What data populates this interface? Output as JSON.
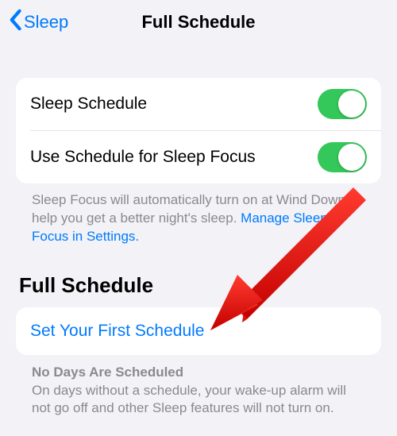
{
  "nav": {
    "back_label": "Sleep",
    "title": "Full Schedule"
  },
  "card1": {
    "row1_label": "Sleep Schedule",
    "row1_toggle_on": true,
    "row2_label": "Use Schedule for Sleep Focus",
    "row2_toggle_on": true
  },
  "footer1": {
    "text": "Sleep Focus will automatically turn on at Wind Down to help you get a better night's sleep. ",
    "link": "Manage Sleep Focus in Settings."
  },
  "section2": {
    "header": "Full Schedule",
    "link_row": "Set Your First Schedule"
  },
  "footnote": {
    "title": "No Days Are Scheduled",
    "body": "On days without a schedule, your wake-up alarm will not go off and other Sleep features will not turn on."
  },
  "annotation": {
    "arrow_color": "#ff0000"
  }
}
